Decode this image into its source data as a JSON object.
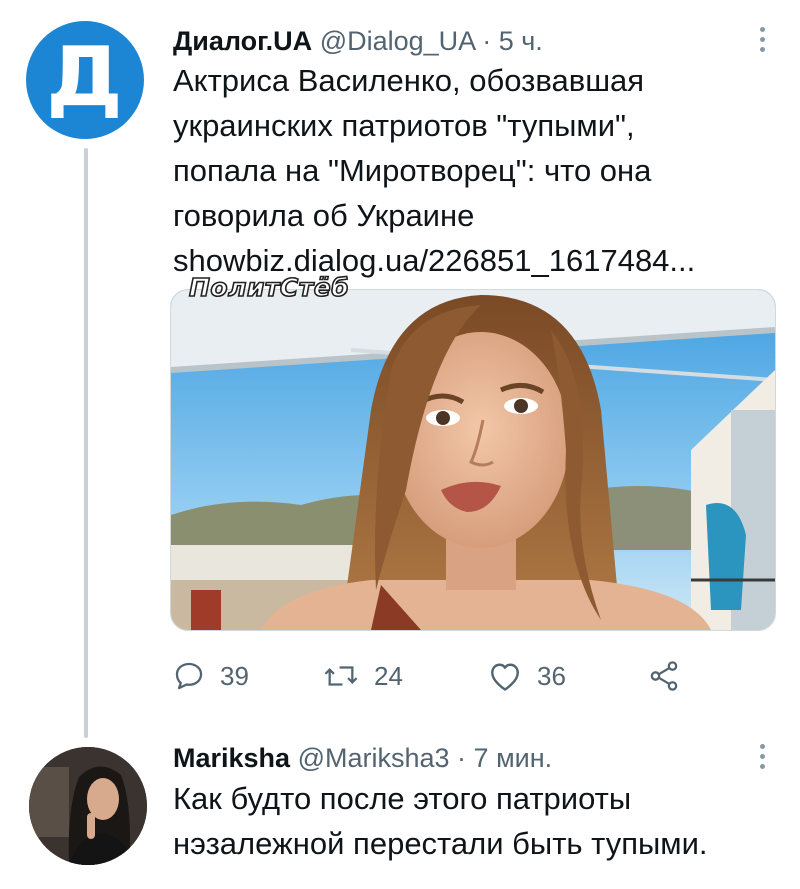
{
  "tweet1": {
    "avatar_letter": "Д",
    "author_name": "Диалог.UA",
    "handle": "@Dialog_UA",
    "separator": " · ",
    "time": "5 ч.",
    "text_lines": [
      "Актриса Василенко, обозвавшая",
      "украинских патриотов \"тупыми\",",
      "попала на \"Миротворец\": что она",
      "говорила об Украине"
    ],
    "link": "showbiz.dialog.ua/226851_1617484...",
    "watermark": "ПолитСтёб",
    "stats": {
      "replies": "39",
      "retweets": "24",
      "likes": "36"
    },
    "icons": [
      "reply-icon",
      "retweet-icon",
      "like-icon",
      "share-icon",
      "more-icon"
    ]
  },
  "tweet2": {
    "author_name": "Mariksha",
    "handle": "@Mariksha3",
    "separator": " · ",
    "time": "7 мин.",
    "text_lines": [
      "Как будто после этого патриоты",
      "нэзалежной перестали быть тупыми."
    ]
  },
  "colors": {
    "avatar_blue": "#1d86d4",
    "text": "#0f1419",
    "secondary": "#536471",
    "thread_line": "#c8d1d8"
  }
}
